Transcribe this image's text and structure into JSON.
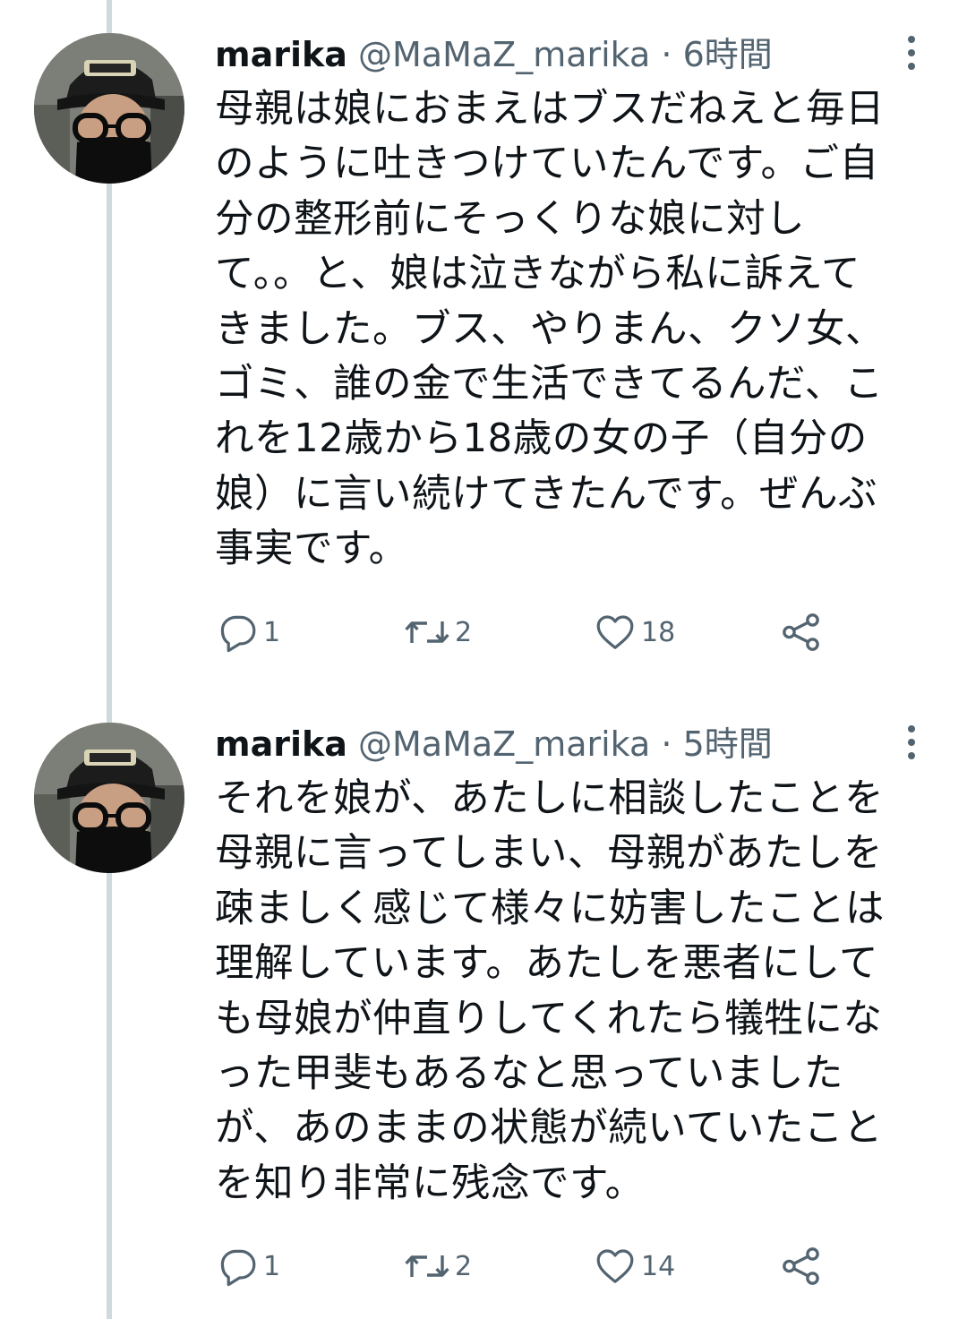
{
  "tweets": [
    {
      "name": "marika",
      "handle": "@MaMaZ_marika",
      "separator": "·",
      "time": "6時間",
      "text": "母親は娘におまえはブスだねえと毎日のように吐きつけていたんです。ご自分の整形前にそっくりな娘に対して。。と、娘は泣きながら私に訴えてきました。ブス、やりまん、クソ女、ゴミ、誰の金で生活できてるんだ、これを12歳から18歳の女の子（自分の娘）に言い続けてきたんです。ぜんぶ事実です。",
      "lines": [
        "母親は娘におまえはブスだねえと毎日",
        "のように吐きつけていたんです。ご自",
        "分の整形前にそっくりな娘に対し",
        "て。。と、娘は泣きながら私に訴えて",
        "きました。ブス、やりまん、クソ女、",
        "ゴミ、誰の金で生活できてるんだ、こ",
        "れを12歳から18歳の女の子（自分の",
        "娘）に言い続けてきたんです。ぜんぶ",
        "事実です。"
      ],
      "replies": "1",
      "retweets": "2",
      "likes": "18"
    },
    {
      "name": "marika",
      "handle": "@MaMaZ_marika",
      "separator": "·",
      "time": "5時間",
      "text": "それを娘が、あたしに相談したことを母親に言ってしまい、母親があたしを疎ましく感じて様々に妨害したことは理解しています。あたしを悪者にしても母娘が仲直りしてくれたら犠牲になった甲斐もあるなと思っていましたが、あのままの状態が続いていたことを知り非常に残念です。",
      "lines": [
        "それを娘が、あたしに相談したことを",
        "母親に言ってしまい、母親があたしを",
        "疎ましく感じて様々に妨害したことは",
        "理解しています。あたしを悪者にして",
        "も母娘が仲直りしてくれたら犠牲にな",
        "った甲斐もあるなと思っていました",
        "が、あのままの状態が続いていたこと",
        "を知り非常に残念です。"
      ],
      "replies": "1",
      "retweets": "2",
      "likes": "14"
    }
  ],
  "icons": {
    "avatar": "avatar-photo-icon",
    "more": "more-vertical-icon",
    "reply": "reply-icon",
    "retweet": "retweet-icon",
    "like": "heart-icon",
    "share": "share-icon"
  },
  "colors": {
    "text": "#0f1419",
    "secondary": "#536471",
    "thread_line": "#cfd9de",
    "background": "#ffffff"
  }
}
